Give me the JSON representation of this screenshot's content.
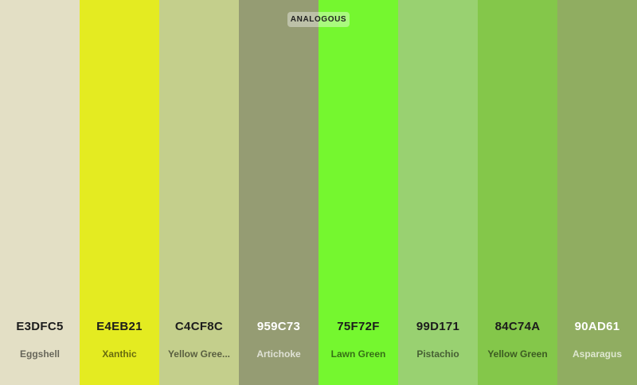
{
  "scheme": {
    "badge_label": "ANALOGOUS"
  },
  "swatches": [
    {
      "hex": "E3DFC5",
      "name": "Eggshell",
      "color": "#E3DFC5",
      "text_tone": "dark"
    },
    {
      "hex": "E4EB21",
      "name": "Xanthic",
      "color": "#E4EB21",
      "text_tone": "dark"
    },
    {
      "hex": "C4CF8C",
      "name": "Yellow Gree...",
      "color": "#C4CF8C",
      "text_tone": "dark"
    },
    {
      "hex": "959C73",
      "name": "Artichoke",
      "color": "#959C73",
      "text_tone": "light"
    },
    {
      "hex": "75F72F",
      "name": "Lawn Green",
      "color": "#75F72F",
      "text_tone": "dark"
    },
    {
      "hex": "99D171",
      "name": "Pistachio",
      "color": "#99D171",
      "text_tone": "dark"
    },
    {
      "hex": "84C74A",
      "name": "Yellow Green",
      "color": "#84C74A",
      "text_tone": "dark"
    },
    {
      "hex": "90AD61",
      "name": "Asparagus",
      "color": "#90AD61",
      "text_tone": "light"
    }
  ]
}
